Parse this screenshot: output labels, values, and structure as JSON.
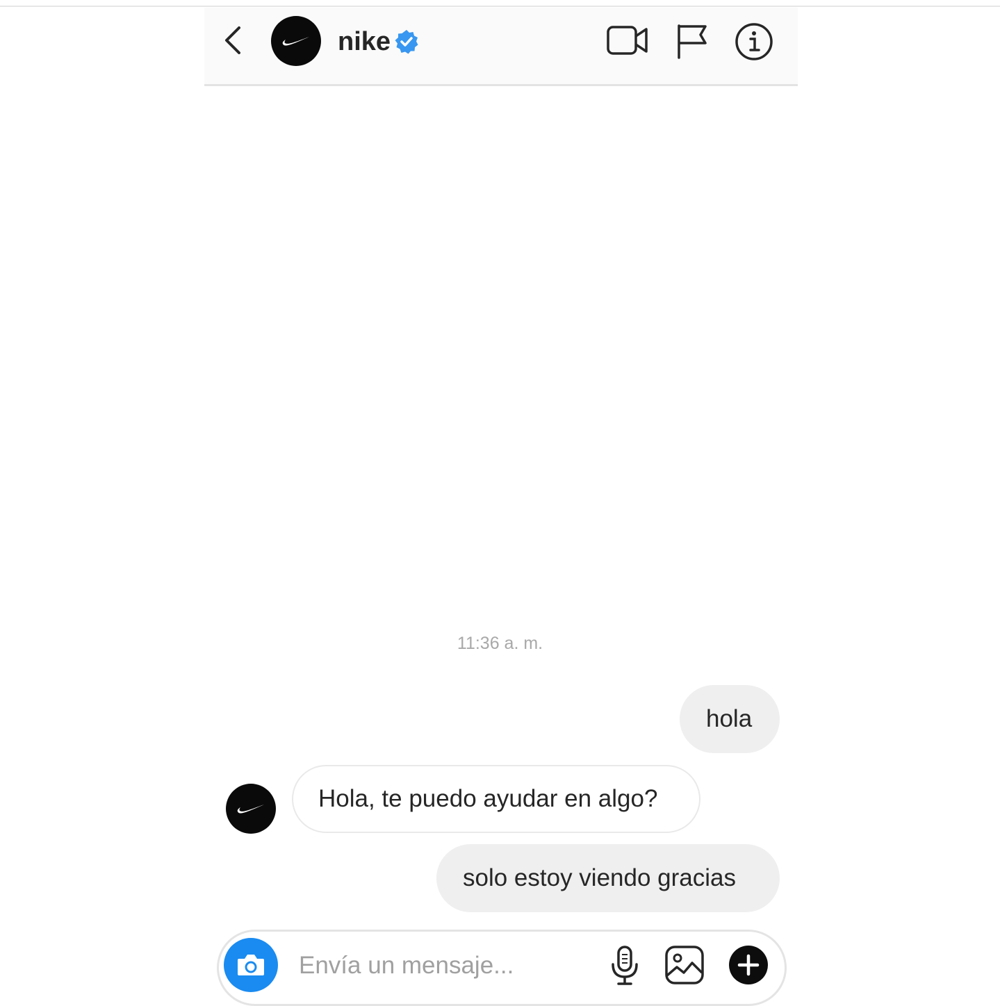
{
  "header": {
    "username": "nike",
    "verified": true,
    "icons": [
      "back-chevron-icon",
      "video-call-icon",
      "report-flag-icon",
      "info-icon"
    ]
  },
  "thread": {
    "timestamp": "11:36 a. m.",
    "messages": [
      {
        "sender": "me",
        "text": "hola"
      },
      {
        "sender": "nike",
        "text": "Hola, te puedo ayudar en algo?"
      },
      {
        "sender": "me",
        "text": "solo estoy viendo gracias"
      }
    ]
  },
  "composer": {
    "placeholder": "Envía un mensaje...",
    "value": "",
    "icons": [
      "camera-icon",
      "microphone-icon",
      "gallery-icon",
      "plus-icon"
    ]
  },
  "colors": {
    "verified_blue": "#3897f0",
    "camera_blue": "#1a8bf0",
    "outgoing_bubble": "#efefef",
    "avatar_black": "#0a0a0a"
  }
}
